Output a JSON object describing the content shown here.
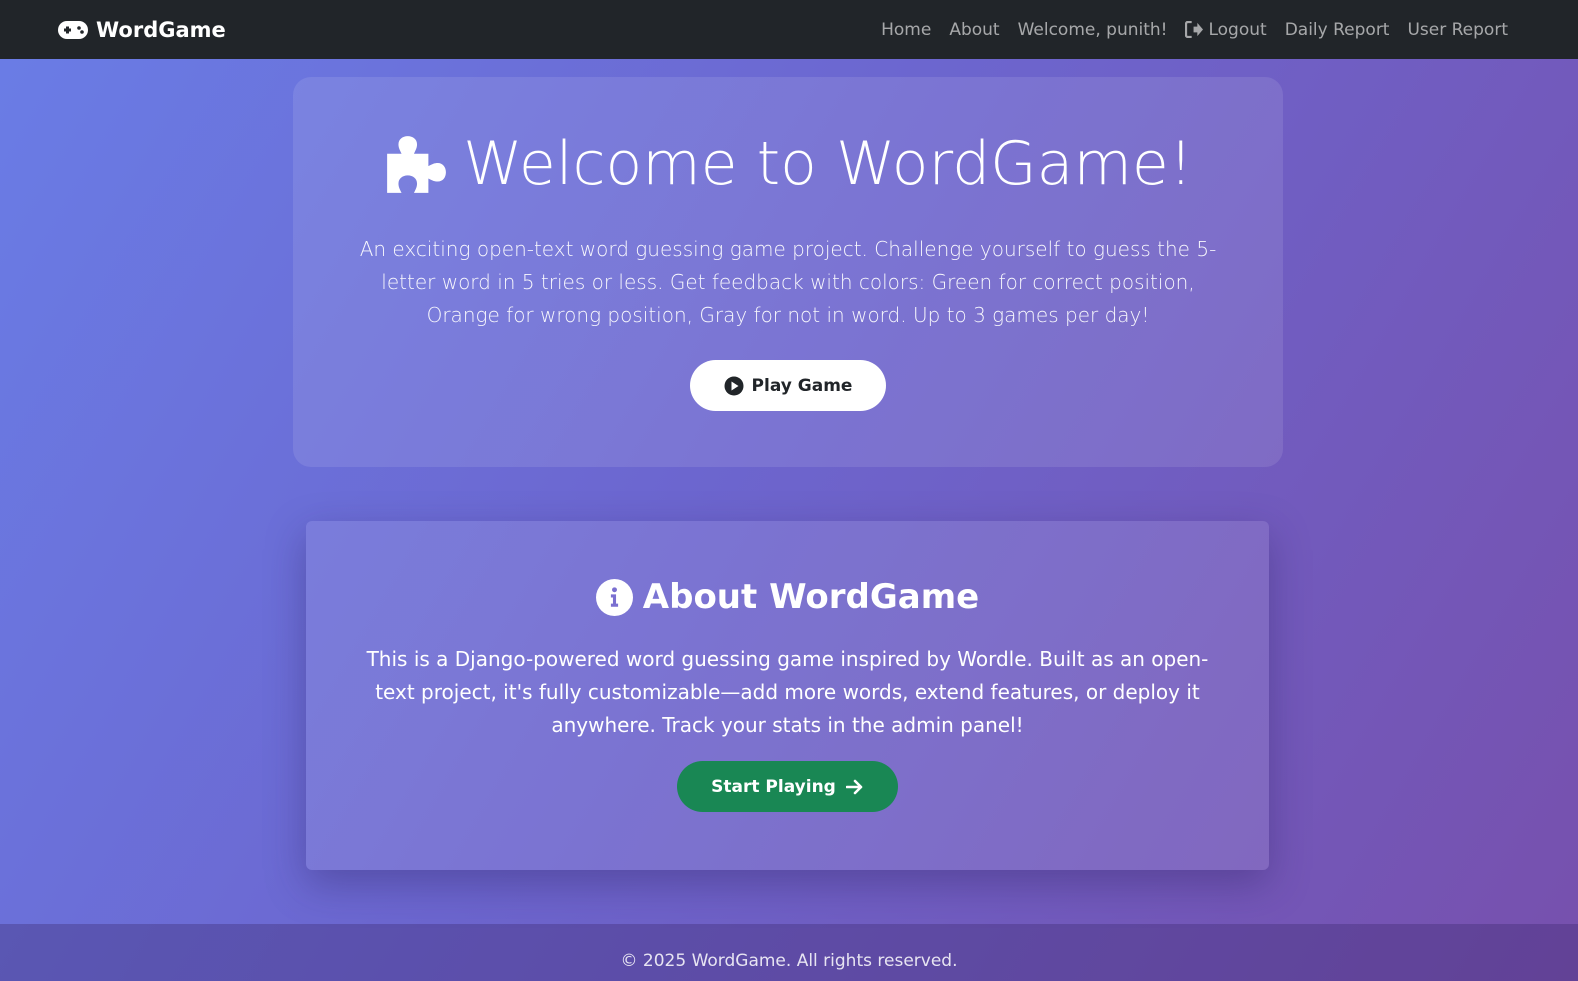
{
  "navbar": {
    "brand": "WordGame",
    "brand_icon": "gamepad-icon",
    "links": {
      "home": "Home",
      "about": "About",
      "welcome": "Welcome, punith!",
      "logout": "Logout",
      "daily_report": "Daily Report",
      "user_report": "User Report"
    }
  },
  "hero": {
    "icon": "puzzle-piece-icon",
    "title": "Welcome to WordGame!",
    "lead": "An exciting open-text word guessing game project. Challenge yourself to guess the 5-letter word in 5 tries or less. Get feedback with colors: Green for correct position, Orange for wrong position, Gray for not in word. Up to 3 games per day!",
    "play_button": "Play Game"
  },
  "about": {
    "icon": "info-circle-icon",
    "title": "About WordGame",
    "text": "This is a Django-powered word guessing game inspired by Wordle. Built as an open-text project, it's fully customizable—add more words, extend features, or deploy it anywhere. Track your stats in the admin panel!",
    "start_button": "Start Playing"
  },
  "footer": {
    "text": "© 2025 WordGame. All rights reserved."
  },
  "colors": {
    "navbar": "#212529",
    "start_button": "#198754",
    "gradient_start": "#6a7de6",
    "gradient_end": "#7750ad"
  }
}
